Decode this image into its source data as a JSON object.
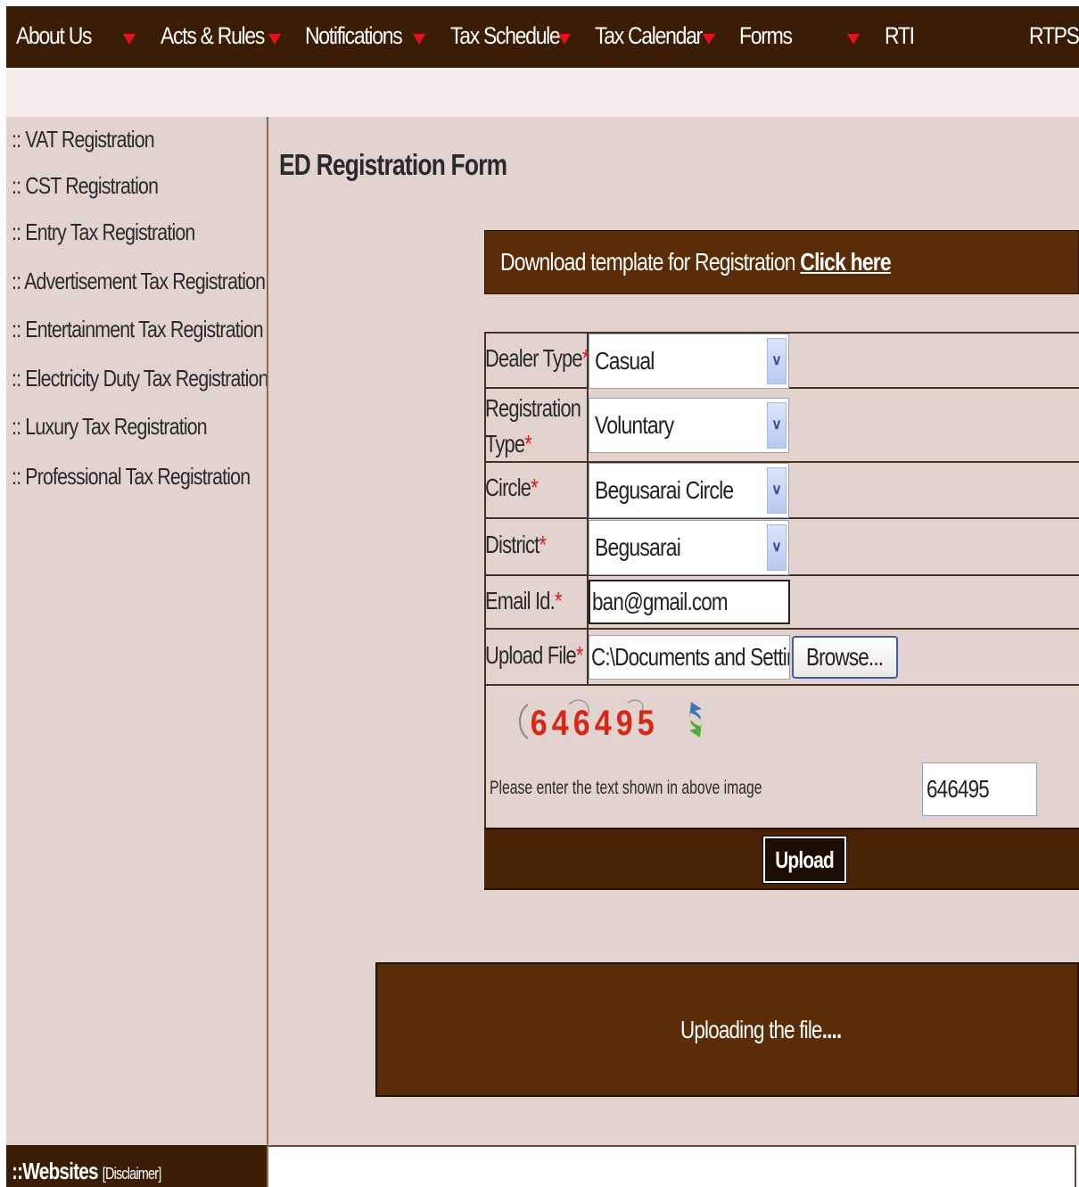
{
  "nav": {
    "items": [
      "About Us",
      "Acts & Rules",
      "Notifications",
      "Tax Schedule",
      "Tax Calendar",
      "Forms",
      "RTI",
      "RTPS"
    ]
  },
  "sidebar": {
    "items": [
      ":: VAT Registration",
      ":: CST Registration",
      ":: Entry Tax Registration",
      ":: Advertisement Tax Registration",
      ":: Entertainment Tax Registration",
      ":: Electricity Duty Tax Registration",
      ":: Luxury Tax Registration",
      ":: Professional Tax Registration"
    ]
  },
  "page": {
    "title": "ED Registration Form",
    "download_text": "Download template for Registration ",
    "download_link": "Click here"
  },
  "form": {
    "dealer_type_label": "Dealer Type",
    "dealer_type_value": "Casual",
    "registration_type_label_1": "Registration",
    "registration_type_label_2": "Type",
    "registration_type_value": "Voluntary",
    "circle_label": "Circle",
    "circle_value": "Begusarai Circle",
    "district_label": "District",
    "district_value": "Begusarai",
    "email_label": "Email Id.",
    "email_value": "ban@gmail.com",
    "upload_label": "Upload File",
    "upload_value": "C:\\Documents and Settin",
    "browse_label": "Browse...",
    "required_mark": "*",
    "captcha_text": "646495",
    "captcha_prompt": "Please enter the text shown in above image",
    "captcha_value": "646495",
    "upload_button": "Upload"
  },
  "status": {
    "uploading": "Uploading the file",
    "dots": "...."
  },
  "footer": {
    "websites": "::Websites",
    "disclaimer": "[Disclaimer]"
  },
  "colors": {
    "nav_bg": "#3b1c04",
    "panel_bg": "#e3d3cf",
    "bar_bg": "#5a2c08",
    "required": "#d4201a",
    "captcha_digits": "#d4281a"
  }
}
